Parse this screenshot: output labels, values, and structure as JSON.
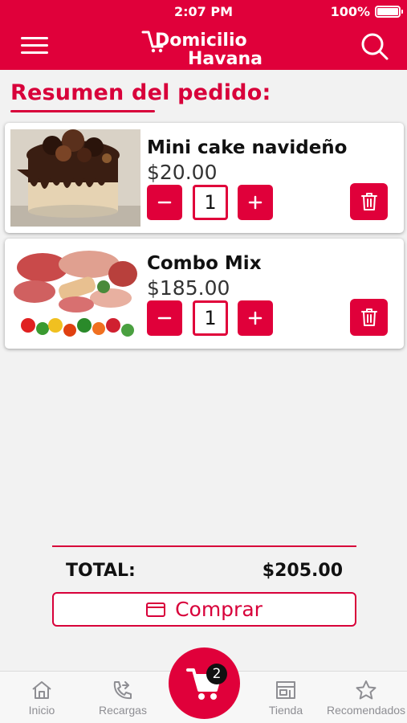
{
  "status_bar": {
    "time": "2:07 PM",
    "battery_percent": "100%"
  },
  "header": {
    "logo_line1": "Domicilio",
    "logo_line2": "Havana"
  },
  "page": {
    "title": "Resumen del pedido:"
  },
  "cart_items": [
    {
      "name": "Mini cake navideño",
      "price": "$20.00",
      "quantity": "1"
    },
    {
      "name": "Combo Mix",
      "price": "$185.00",
      "quantity": "1"
    }
  ],
  "summary": {
    "total_label": "TOTAL:",
    "total_value": "$205.00",
    "buy_label": "Comprar"
  },
  "bottom_nav": {
    "items": [
      {
        "label": "Inicio",
        "icon": "home-icon"
      },
      {
        "label": "Recargas",
        "icon": "phone-icon"
      },
      {
        "label": "Tienda",
        "icon": "store-icon"
      },
      {
        "label": "Recomendados",
        "icon": "star-icon"
      }
    ],
    "cart_count": "2"
  },
  "colors": {
    "brand": "#e0003a",
    "background": "#f2f2f2",
    "nav_text": "#8e8e93"
  }
}
